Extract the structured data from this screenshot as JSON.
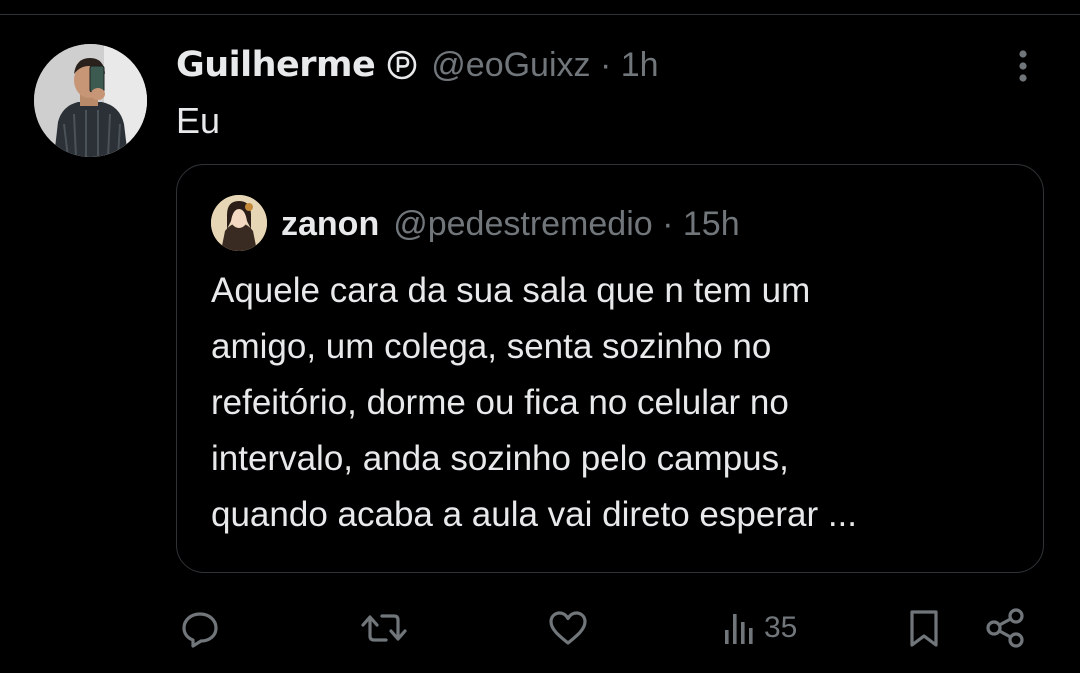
{
  "tweet": {
    "author_name": "Guilherme",
    "author_badge": "parody-badge-icon",
    "handle": "@eoGuixz",
    "separator": "·",
    "time": "1h",
    "text": "Eu"
  },
  "quote": {
    "author_name": "zanon",
    "handle": "@pedestremedio",
    "separator": "·",
    "time": "15h",
    "text": "Aquele cara da sua sala que n tem um\namigo, um colega, senta sozinho no\nrefeitório, dorme ou fica no celular no\nintervalo, anda sozinho pelo campus,\nquando acaba a aula vai direto esperar ..."
  },
  "actions": {
    "views": "35",
    "icons": [
      "reply-icon",
      "retweet-icon",
      "like-icon",
      "views-icon",
      "bookmark-icon",
      "share-icon"
    ]
  },
  "colors": {
    "background": "#000000",
    "text_primary": "#e7e9ea",
    "text_secondary": "#71767b",
    "border": "#2f3336"
  }
}
